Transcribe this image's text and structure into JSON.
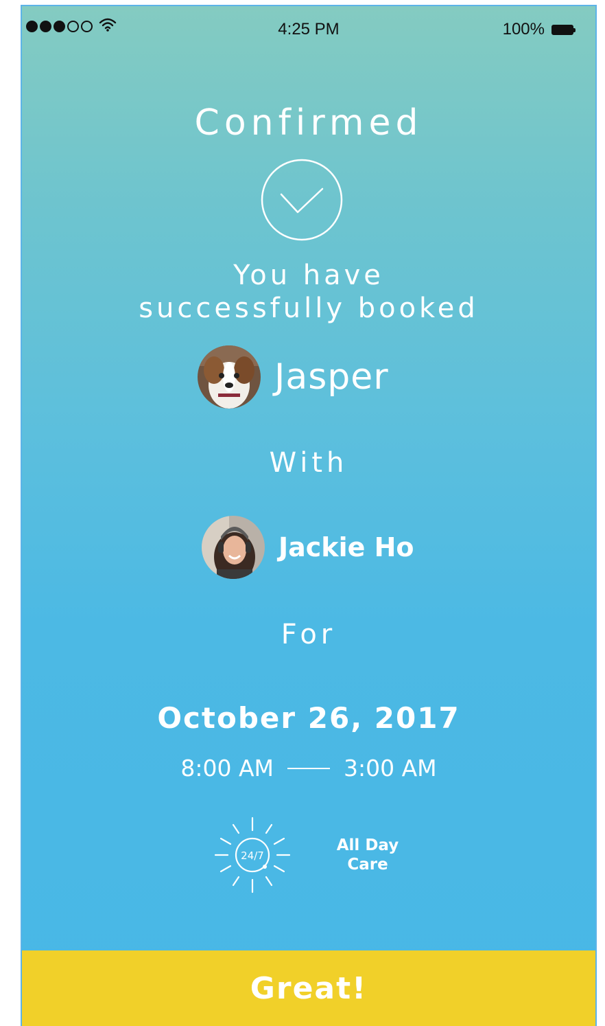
{
  "status_bar": {
    "signal_filled": 3,
    "signal_total": 5,
    "wifi_icon": "wifi-icon",
    "time": "4:25 PM",
    "battery_text": "100%",
    "battery_icon": "battery-icon"
  },
  "confirmation": {
    "title": "Confirmed",
    "check_icon": "check-circle-icon",
    "message_line1": "You have",
    "message_line2": "successfully booked"
  },
  "pet": {
    "name": "Jasper",
    "avatar": "dog-avatar"
  },
  "with_label": "With",
  "sitter": {
    "name": "Jackie Ho",
    "avatar": "sitter-avatar"
  },
  "for_label": "For",
  "booking": {
    "date": "October 26, 2017",
    "start_time": "8:00 AM",
    "end_time": "3:00 AM",
    "service_icon": "sun-24-7-icon",
    "service_line1": "All Day",
    "service_line2": "Care",
    "service_icon_text": "24/7"
  },
  "action": {
    "button_label": "Great!"
  },
  "colors": {
    "gradient_top": "#84cbc1",
    "gradient_bottom": "#48b7e6",
    "button": "#f1d029",
    "text": "#ffffff"
  }
}
